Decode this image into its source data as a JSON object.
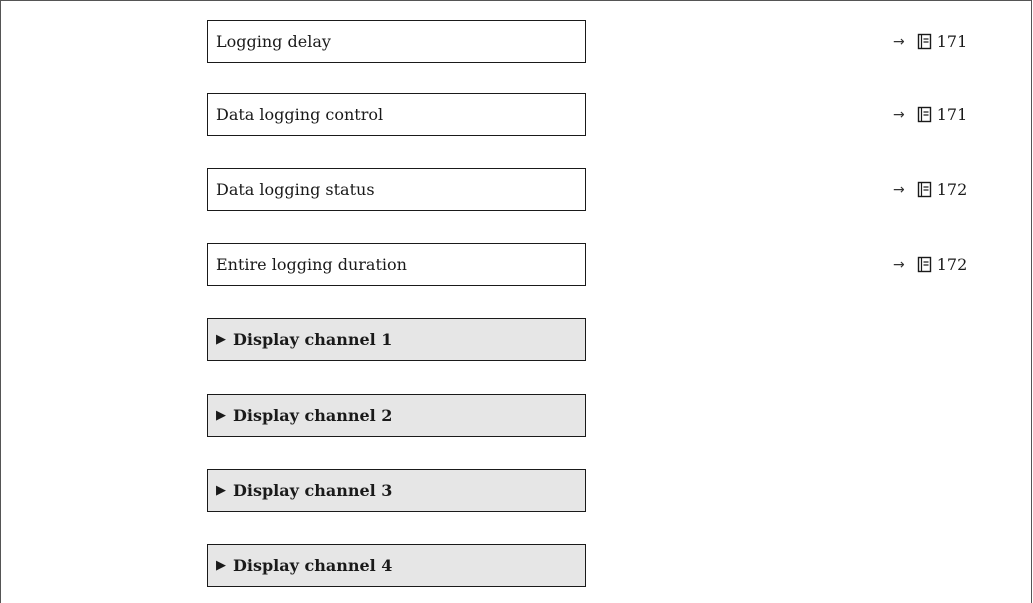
{
  "parameters": [
    {
      "label": "Logging delay",
      "ref_page": "171"
    },
    {
      "label": "Data logging control",
      "ref_page": "171"
    },
    {
      "label": "Data logging status",
      "ref_page": "172"
    },
    {
      "label": "Entire logging duration",
      "ref_page": "172"
    }
  ],
  "submenus": [
    {
      "label": "Display channel 1"
    },
    {
      "label": "Display channel 2"
    },
    {
      "label": "Display channel 3"
    },
    {
      "label": "Display channel 4"
    }
  ],
  "icons": {
    "arrow": "right-arrow-icon",
    "page_ref": "book-icon",
    "submenu": "triangle-right-icon"
  },
  "symbols": {
    "arrow": "→",
    "triangle": "▶"
  }
}
